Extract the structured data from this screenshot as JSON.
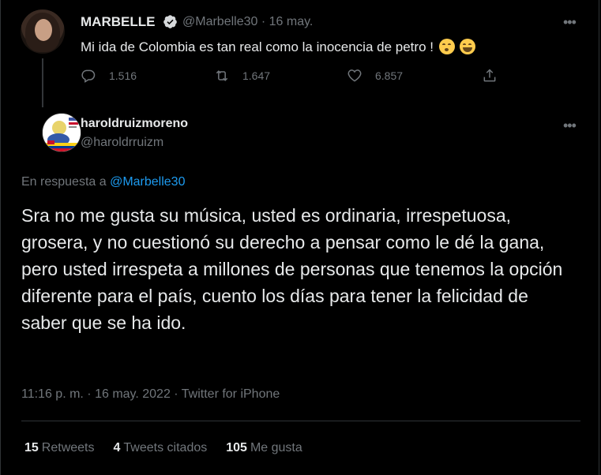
{
  "parent_tweet": {
    "author_name": "MARBELLE",
    "handle_date": "@Marbelle30 · 16 may.",
    "text": "Mi ida de Colombia es tan real como la inocencia de petro !",
    "emojis": [
      "kissing-face-emoji",
      "grinning-squinting-face-emoji"
    ],
    "replies": "1.516",
    "retweets": "1.647",
    "likes": "6.857"
  },
  "main_tweet": {
    "author_name": "haroldruizmoreno",
    "handle": "@haroldrruizm",
    "reply_prefix": "En respuesta a",
    "reply_handle": "@Marbelle30",
    "text": "Sra no me gusta su música, usted es ordinaria, irrespetuosa, grosera, y no cuestionó su derecho a pensar como le dé la gana, pero usted irrespeta a millones de personas que tenemos la opción diferente para el país, cuento los días para tener la felicidad de saber que se ha ido.",
    "meta": "11:16 p. m. · 16 may. 2022 · Twitter for iPhone",
    "stats": {
      "retweets_count": "15",
      "retweets_label": "Retweets",
      "quotes_count": "4",
      "quotes_label": "Tweets citados",
      "likes_count": "105",
      "likes_label": "Me gusta"
    }
  },
  "colors": {
    "background": "#000000",
    "text": "#e7e9ea",
    "muted": "#71767b",
    "link": "#1d9bf0",
    "verified": "#d6d9db"
  }
}
